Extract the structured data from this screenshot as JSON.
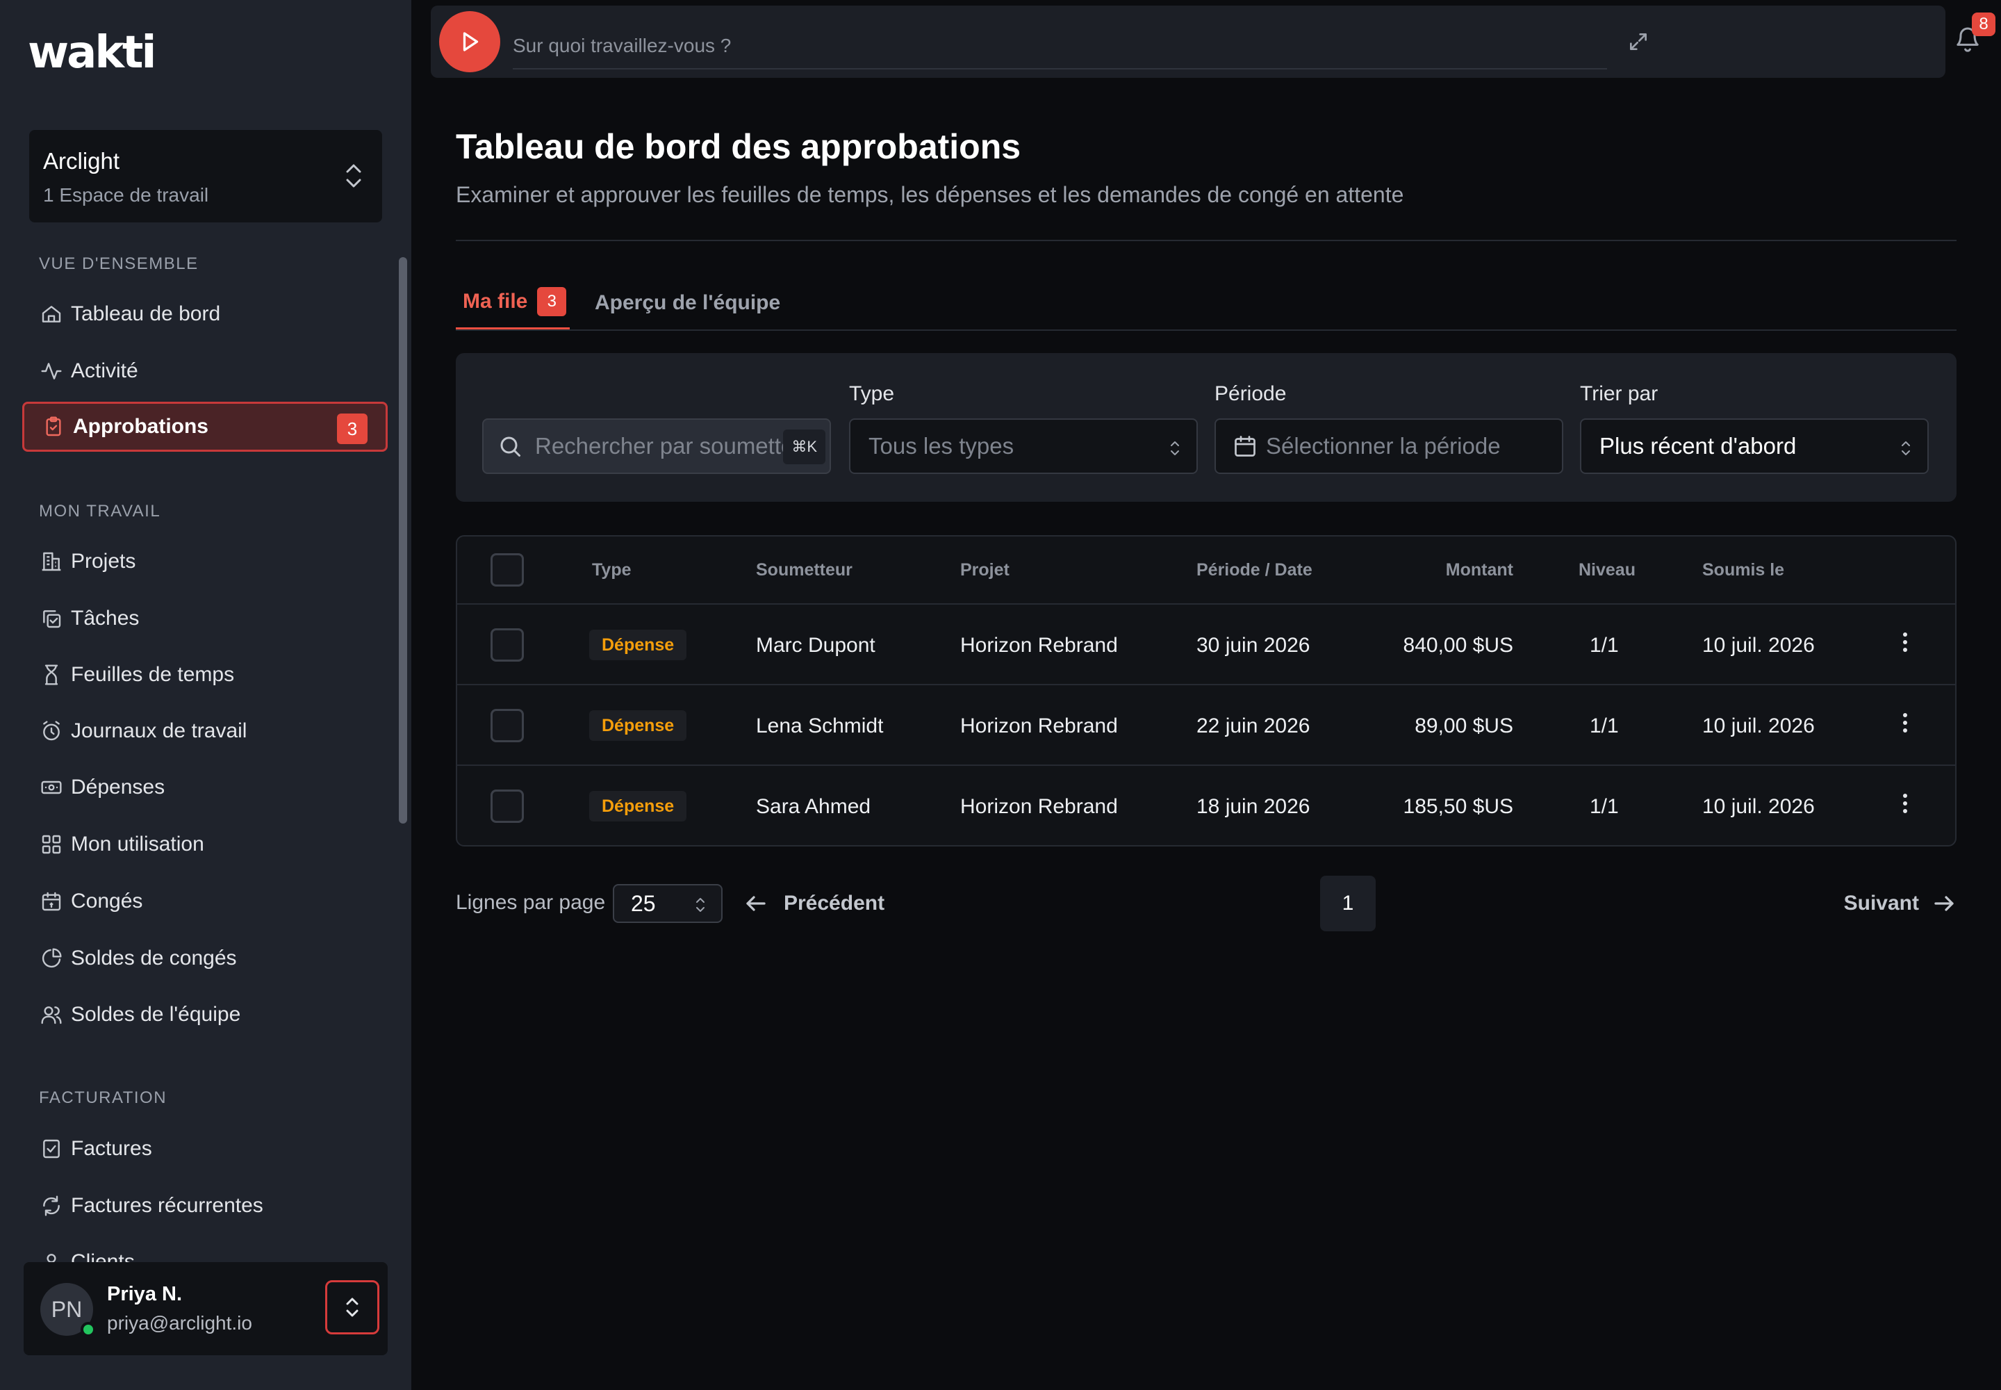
{
  "app": {
    "logo": "wakti"
  },
  "workspace": {
    "name": "Arclight",
    "subtitle": "1 Espace de travail"
  },
  "sidebar": {
    "sections": [
      {
        "label": "VUE D'ENSEMBLE"
      },
      {
        "label": "MON TRAVAIL"
      },
      {
        "label": "FACTURATION"
      }
    ],
    "items": [
      {
        "label": "Tableau de bord",
        "icon": "home-icon"
      },
      {
        "label": "Activité",
        "icon": "activity-icon"
      },
      {
        "label": "Approbations",
        "icon": "clipboard-check-icon",
        "badge": "3",
        "active": true
      },
      {
        "label": "Projets",
        "icon": "building-icon"
      },
      {
        "label": "Tâches",
        "icon": "copy-check-icon"
      },
      {
        "label": "Feuilles de temps",
        "icon": "hourglass-icon"
      },
      {
        "label": "Journaux de travail",
        "icon": "alarm-clock-icon"
      },
      {
        "label": "Dépenses",
        "icon": "banknote-icon"
      },
      {
        "label": "Mon utilisation",
        "icon": "grid-icon"
      },
      {
        "label": "Congés",
        "icon": "calendar-icon"
      },
      {
        "label": "Soldes de congés",
        "icon": "pie-chart-icon"
      },
      {
        "label": "Soldes de l'équipe",
        "icon": "users-icon"
      },
      {
        "label": "Factures",
        "icon": "receipt-icon"
      },
      {
        "label": "Factures récurrentes",
        "icon": "refresh-icon"
      },
      {
        "label": "Clients",
        "icon": "user-icon"
      }
    ]
  },
  "user": {
    "initials": "PN",
    "name": "Priya N.",
    "email": "priya@arclight.io"
  },
  "topbar": {
    "timer_placeholder": "Sur quoi travaillez-vous ?",
    "notifications_count": "8"
  },
  "page": {
    "title": "Tableau de bord des approbations",
    "subtitle": "Examiner et approuver les feuilles de temps, les dépenses et les demandes de congé en attente"
  },
  "tabs": [
    {
      "label": "Ma file",
      "badge": "3",
      "active": true
    },
    {
      "label": "Aperçu de l'équipe"
    }
  ],
  "filters": {
    "search_placeholder": "Rechercher par soumetteur",
    "search_shortcut": "⌘K",
    "type_label": "Type",
    "type_value": "Tous les types",
    "period_label": "Période",
    "period_placeholder": "Sélectionner la période",
    "sort_label": "Trier par",
    "sort_value": "Plus récent d'abord"
  },
  "table": {
    "columns": [
      "Type",
      "Soumetteur",
      "Projet",
      "Période / Date",
      "Montant",
      "Niveau",
      "Soumis le"
    ],
    "rows": [
      {
        "type": "Dépense",
        "submitter": "Marc Dupont",
        "project": "Horizon Rebrand",
        "period": "30 juin 2026",
        "amount": "840,00 $US",
        "level": "1/1",
        "submitted": "10 juil. 2026"
      },
      {
        "type": "Dépense",
        "submitter": "Lena Schmidt",
        "project": "Horizon Rebrand",
        "period": "22 juin 2026",
        "amount": "89,00 $US",
        "level": "1/1",
        "submitted": "10 juil. 2026"
      },
      {
        "type": "Dépense",
        "submitter": "Sara Ahmed",
        "project": "Horizon Rebrand",
        "period": "18 juin 2026",
        "amount": "185,50 $US",
        "level": "1/1",
        "submitted": "10 juil. 2026"
      }
    ]
  },
  "pagination": {
    "rows_label": "Lignes par page",
    "rows_value": "25",
    "prev_label": "Précédent",
    "page": "1",
    "next_label": "Suivant"
  },
  "colors": {
    "accent": "#e5483d",
    "badge_warning": "#f59e0b",
    "online": "#22c55e"
  }
}
